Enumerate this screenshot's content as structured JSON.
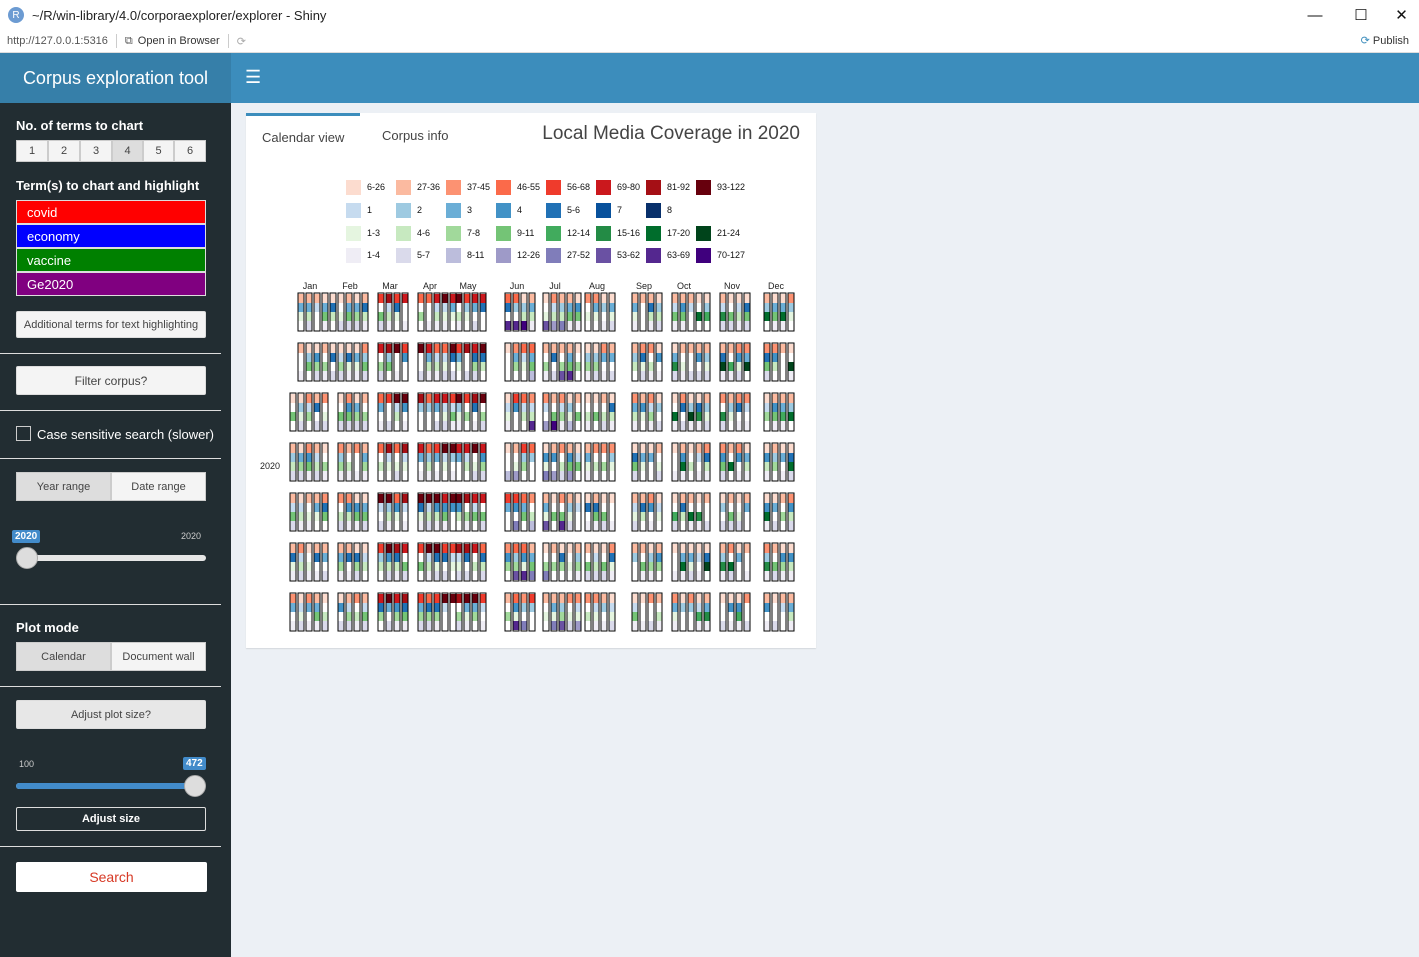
{
  "window": {
    "title": "~/R/win-library/4.0/corporaexplorer/explorer - Shiny",
    "r_icon": "R",
    "url": "http://127.0.0.1:5316",
    "open_in_browser": "Open in Browser",
    "publish": "Publish"
  },
  "sidebar": {
    "logo": "Corpus exploration tool",
    "num_terms_label": "No. of terms to chart",
    "num_terms_options": [
      "1",
      "2",
      "3",
      "4",
      "5",
      "6"
    ],
    "num_terms_selected": "4",
    "terms_label": "Term(s) to chart and highlight",
    "terms": [
      {
        "text": "covid",
        "color": "#ff0000"
      },
      {
        "text": "economy",
        "color": "#0000ff"
      },
      {
        "text": "vaccine",
        "color": "#008000"
      },
      {
        "text": "Ge2020",
        "color": "#800080"
      }
    ],
    "additional_terms_button": "Additional terms for text highlighting",
    "filter_button": "Filter corpus?",
    "case_sensitive_label": "Case sensitive search (slower)",
    "range_tabs": [
      "Year range",
      "Date range"
    ],
    "year_slider": {
      "value": "2020",
      "max": "2020"
    },
    "plot_mode_label": "Plot mode",
    "plot_mode_options": [
      "Calendar",
      "Document wall"
    ],
    "adjust_plot_button": "Adjust plot size?",
    "size_slider": {
      "min": "100",
      "value": "472"
    },
    "adjust_size_button": "Adjust size",
    "search_button": "Search"
  },
  "main": {
    "tabs": [
      "Calendar view",
      "Corpus info"
    ],
    "title": "Local Media Coverage in 2020",
    "year_label": "2020",
    "months": [
      "Jan",
      "Feb",
      "Mar",
      "Apr",
      "May",
      "Jun",
      "Jul",
      "Aug",
      "Sep",
      "Oct",
      "Nov",
      "Dec"
    ],
    "legend": [
      {
        "colors": [
          "#fcdccf",
          "#fbbaa0",
          "#fc9272",
          "#fb6a4a",
          "#ef3b2c",
          "#cb181d",
          "#a50f15",
          "#67000d"
        ],
        "labels": [
          "6-26",
          "27-36",
          "37-45",
          "46-55",
          "56-68",
          "69-80",
          "81-92",
          "93-122"
        ]
      },
      {
        "colors": [
          "#c6dbef",
          "#9ecae1",
          "#6baed6",
          "#4292c6",
          "#2171b5",
          "#08519c",
          "#08306b"
        ],
        "labels": [
          "1",
          "2",
          "3",
          "4",
          "5-6",
          "7",
          "8"
        ]
      },
      {
        "colors": [
          "#e5f5e0",
          "#c7e9c0",
          "#a1d99b",
          "#74c476",
          "#41ab5d",
          "#238b45",
          "#006d2c",
          "#00441b"
        ],
        "labels": [
          "1-3",
          "4-6",
          "7-8",
          "9-11",
          "12-14",
          "15-16",
          "17-20",
          "21-24"
        ]
      },
      {
        "colors": [
          "#efedf5",
          "#dadaeb",
          "#bcbddc",
          "#9e9ac8",
          "#807dba",
          "#6a51a3",
          "#54278f",
          "#3f007d"
        ],
        "labels": [
          "1-4",
          "5-7",
          "8-11",
          "12-26",
          "27-52",
          "53-62",
          "63-69",
          "70-127"
        ]
      }
    ]
  }
}
